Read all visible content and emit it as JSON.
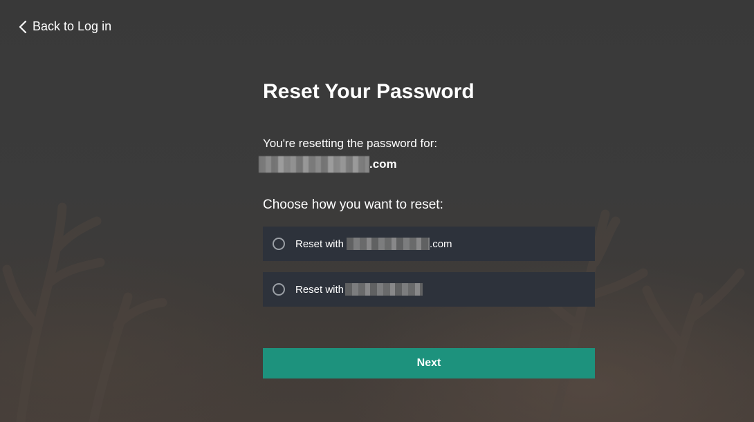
{
  "nav": {
    "back_label": "Back to Log in",
    "back_icon": "chevron-left-icon"
  },
  "reset": {
    "title": "Reset Your Password",
    "intro": "You're resetting the password for:",
    "account_suffix": ".com",
    "choose_label": "Choose how you want to reset:",
    "options": [
      {
        "label_prefix": "Reset with",
        "label_suffix": ".com",
        "selected": false
      },
      {
        "label_prefix": "Reset with",
        "label_suffix": "",
        "selected": false
      }
    ],
    "next_label": "Next"
  },
  "colors": {
    "background": "#3c3c3c",
    "option_background": "#2d323b",
    "primary_button": "#1d927d",
    "text": "#ffffff",
    "radio_border": "#9ba0a6"
  }
}
